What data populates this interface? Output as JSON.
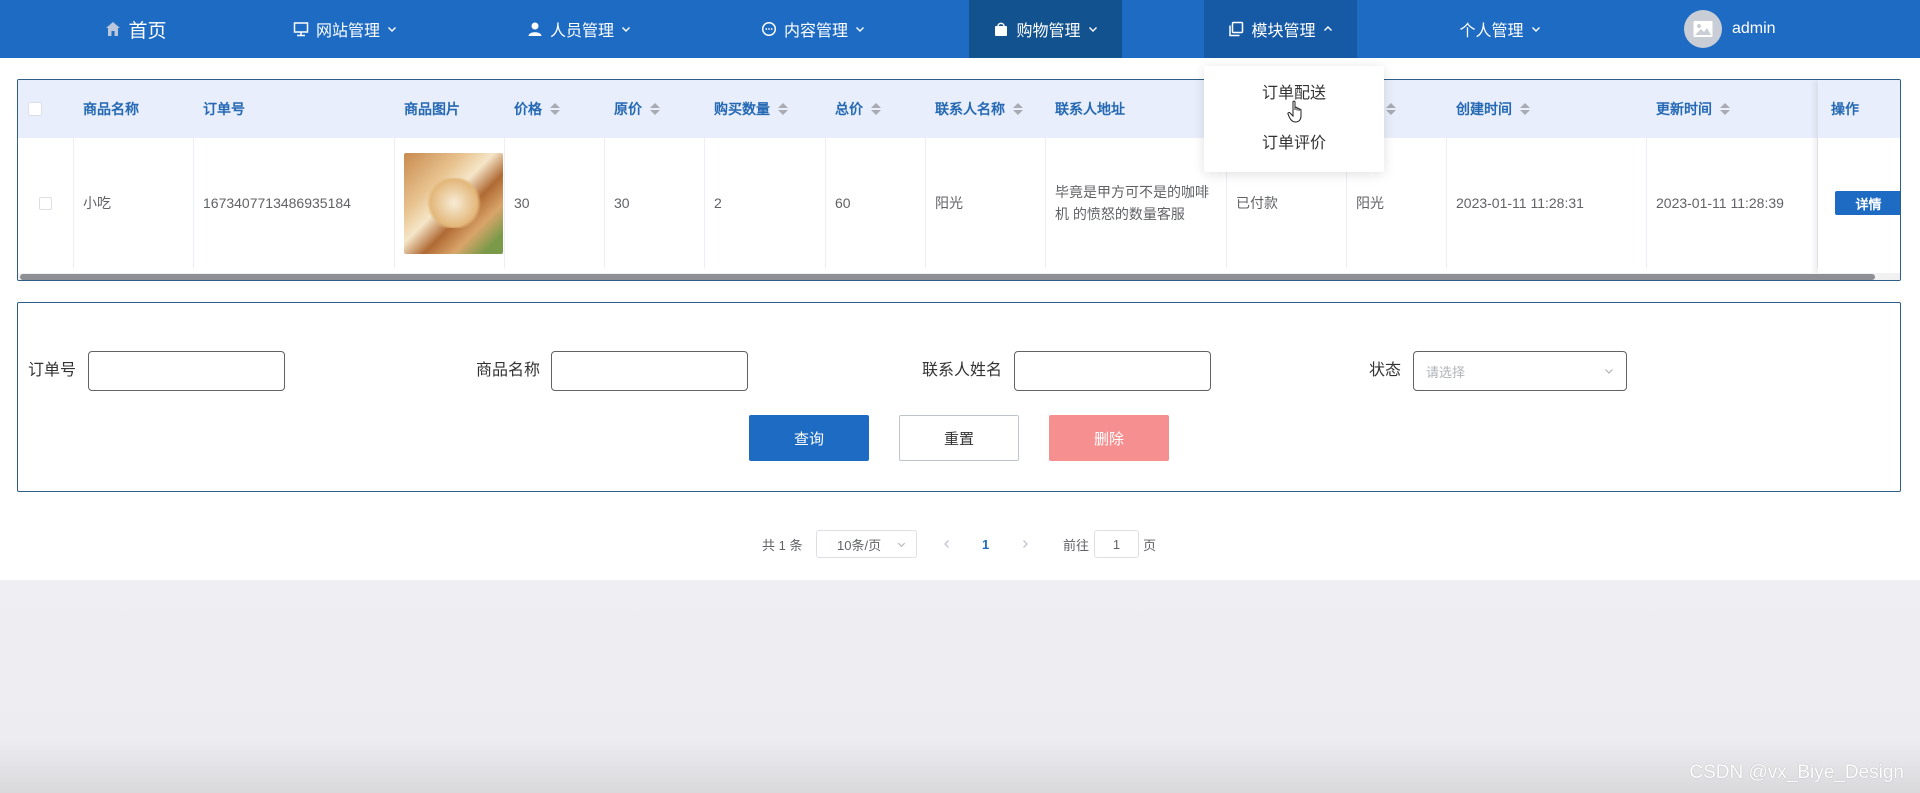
{
  "nav": {
    "items": [
      {
        "label": "首页",
        "icon": "home-icon"
      },
      {
        "label": "网站管理",
        "icon": "monitor-icon"
      },
      {
        "label": "人员管理",
        "icon": "user-icon"
      },
      {
        "label": "内容管理",
        "icon": "chat-icon"
      },
      {
        "label": "购物管理",
        "icon": "bag-icon"
      },
      {
        "label": "模块管理",
        "icon": "copy-icon"
      },
      {
        "label": "个人管理",
        "icon": ""
      }
    ],
    "user": {
      "name": "admin",
      "avatar_icon": "image-icon"
    },
    "color": "#1e6bc4",
    "active_color": "#11528f"
  },
  "dropdown": {
    "items": [
      "订单配送",
      "订单评价"
    ]
  },
  "table": {
    "headers": [
      "商品名称",
      "订单号",
      "商品图片",
      "价格",
      "原价",
      "购买数量",
      "总价",
      "联系人名称",
      "联系人地址",
      "创建时间",
      "更新时间",
      "操作"
    ],
    "row": {
      "name": "小吃",
      "order_no": "1673407713486935184",
      "price": "30",
      "orig_price": "30",
      "qty": "2",
      "total": "60",
      "contact": "阳光",
      "address": "毕竟是甲方可不是的咖啡机 的愤怒的数量客服",
      "status": "已付款",
      "receiver": "阳光",
      "created": "2023-01-11 11:28:31",
      "updated": "2023-01-11 11:28:39",
      "action": "详情"
    }
  },
  "form": {
    "order_no_label": "订单号",
    "goods_name_label": "商品名称",
    "contact_name_label": "联系人姓名",
    "status_label": "状态",
    "status_placeholder": "请选择",
    "query": "查询",
    "reset": "重置",
    "delete": "删除"
  },
  "pagination": {
    "total": "共 1 条",
    "size": "10条/页",
    "current": "1",
    "goto": "前往",
    "goto_value": "1",
    "page_suffix": "页"
  },
  "watermark": "CSDN @vx_Biye_Design"
}
